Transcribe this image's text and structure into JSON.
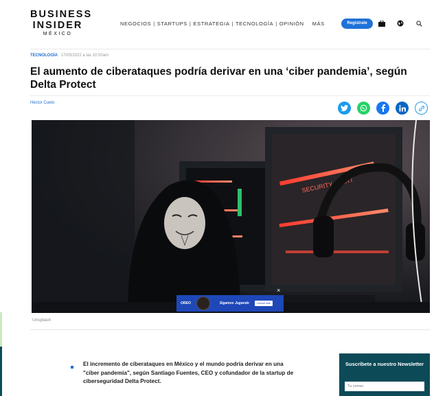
{
  "header": {
    "logo_line1": "BUSINESS",
    "logo_line2": "INSIDER",
    "logo_line3": "MÉXICO",
    "nav": [
      "NEGOCIOS",
      "STARTUPS",
      "ESTRATEGIA",
      "TECNOLOGÍA",
      "OPINIÓN"
    ],
    "nav_separator": "|",
    "more_label": "MÁS",
    "register_label": "Registrate",
    "icons": [
      "briefcase-icon",
      "globe-icon",
      "search-icon"
    ]
  },
  "article": {
    "category": "TECNOLOGÍA",
    "date": "17/05/2022 a las 10:00am",
    "title": "El aumento de ciberataques podría derivar en una ‘ciber pandemia’, según Delta Protect",
    "author": "Héctor Cueto",
    "share": [
      {
        "name": "twitter-icon",
        "color": "#1d9bf0"
      },
      {
        "name": "whatsapp-icon",
        "color": "#25d366"
      },
      {
        "name": "facebook-icon",
        "color": "#1877f2"
      },
      {
        "name": "linkedin-icon",
        "color": "#0a66c2"
      },
      {
        "name": "link-icon",
        "color": "#1d9bf0"
      }
    ],
    "image_text": "SECURITY ALERT",
    "image_caption": "Unsplash",
    "bullet": "El incremento de ciberataques en México y el mundo podría derivar en una \"ciber pandemia\", según Santiago Fuentes, CEO y cofundador de la startup de ciberseguridad Delta Protect."
  },
  "ad": {
    "brand": "OREO",
    "cta": "Sigamos Jugando",
    "button": "Conocé más",
    "close": "×"
  },
  "newsletter": {
    "title": "Suscríbete a nuestro Newsletter",
    "placeholder": "Tu correo"
  },
  "colors": {
    "accent": "#1f6fd1",
    "register": "#1f72d8",
    "newsletter_bg": "#0d4a57"
  }
}
